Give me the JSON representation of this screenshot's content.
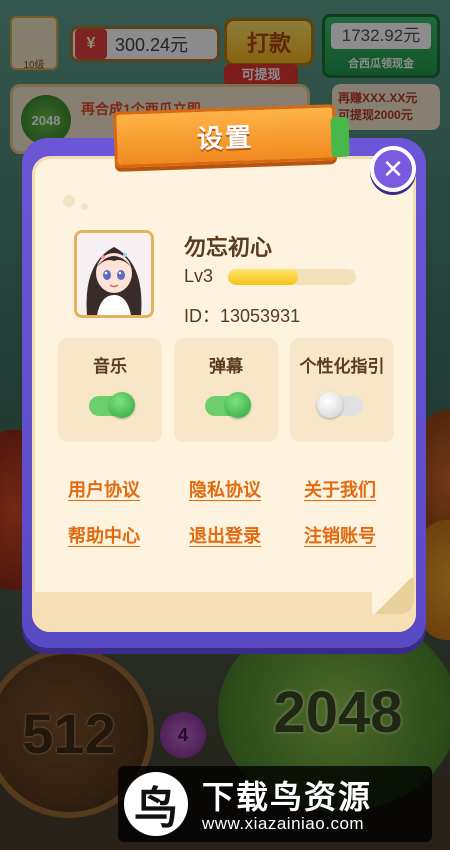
{
  "background": {
    "profile_level": "10级",
    "currency_symbol": "¥",
    "money": "300.24元",
    "payout_button": "打款",
    "withdraw_tag": "可提现",
    "cash_amount": "1732.92元",
    "cash_label": "合西瓜领现金",
    "tip_ball": "2048",
    "tip_text": "再合成1个西瓜立即",
    "earn_line1": "再赚XXX.XX元",
    "earn_line2": "可提现2000元",
    "fruit_512": "512",
    "fruit_2048": "2048",
    "fruit_4": "4"
  },
  "dialog": {
    "title": "设置",
    "close_glyph": "✕",
    "nickname": "勿忘初心",
    "level": "Lv3",
    "level_progress": 0.55,
    "id_text": "ID：13053931",
    "toggles": [
      {
        "label": "音乐",
        "on": true
      },
      {
        "label": "弹幕",
        "on": true
      },
      {
        "label": "个性化指引",
        "on": false
      }
    ],
    "links": {
      "user_agreement": "用户协议",
      "privacy_agreement": "隐私协议",
      "about_us": "关于我们",
      "help_center": "帮助中心",
      "logout": "退出登录",
      "cancel_account": "注销账号"
    }
  },
  "watermark": {
    "title": "下载鸟资源",
    "url": "www.xiazainiao.com"
  },
  "colors": {
    "dialog_frame": "#6a56d6",
    "panel": "#fdf3df",
    "banner": "#f08a1f",
    "link": "#e26b12",
    "toggle_on": "#6ccf6c",
    "toggle_off": "#e1e1e1"
  }
}
